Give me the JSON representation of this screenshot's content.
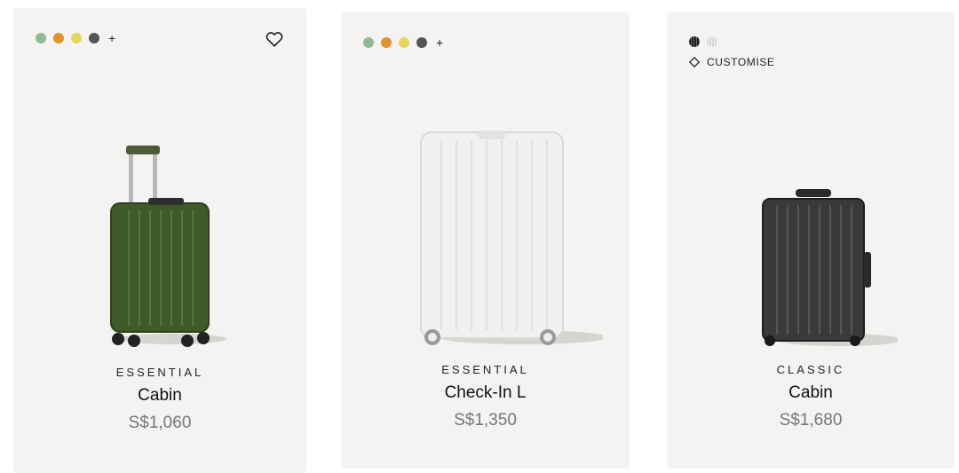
{
  "products": [
    {
      "collection": "ESSENTIAL",
      "name": "Cabin",
      "price": "S$1,060",
      "swatch_colors": [
        "#8fb992",
        "#e3912b",
        "#e6d65b",
        "#555555"
      ],
      "more_colors_label": "+",
      "has_wishlist": true,
      "wishlist_icon": "heart-icon",
      "image": "green-cabin-suitcase"
    },
    {
      "collection": "ESSENTIAL",
      "name": "Check-In L",
      "price": "S$1,350",
      "swatch_colors": [
        "#8fb992",
        "#e3912b",
        "#e6d65b",
        "#555555"
      ],
      "more_colors_label": "+",
      "image": "white-checkin-suitcase"
    },
    {
      "collection": "CLASSIC",
      "name": "Cabin",
      "price": "S$1,680",
      "swatch_colors": [
        "#1f1f1f",
        "#d6d6d6"
      ],
      "customise_label": "CUSTOMISE",
      "customise_icon": "diamond-icon",
      "image": "black-aluminium-cabin-suitcase"
    }
  ]
}
